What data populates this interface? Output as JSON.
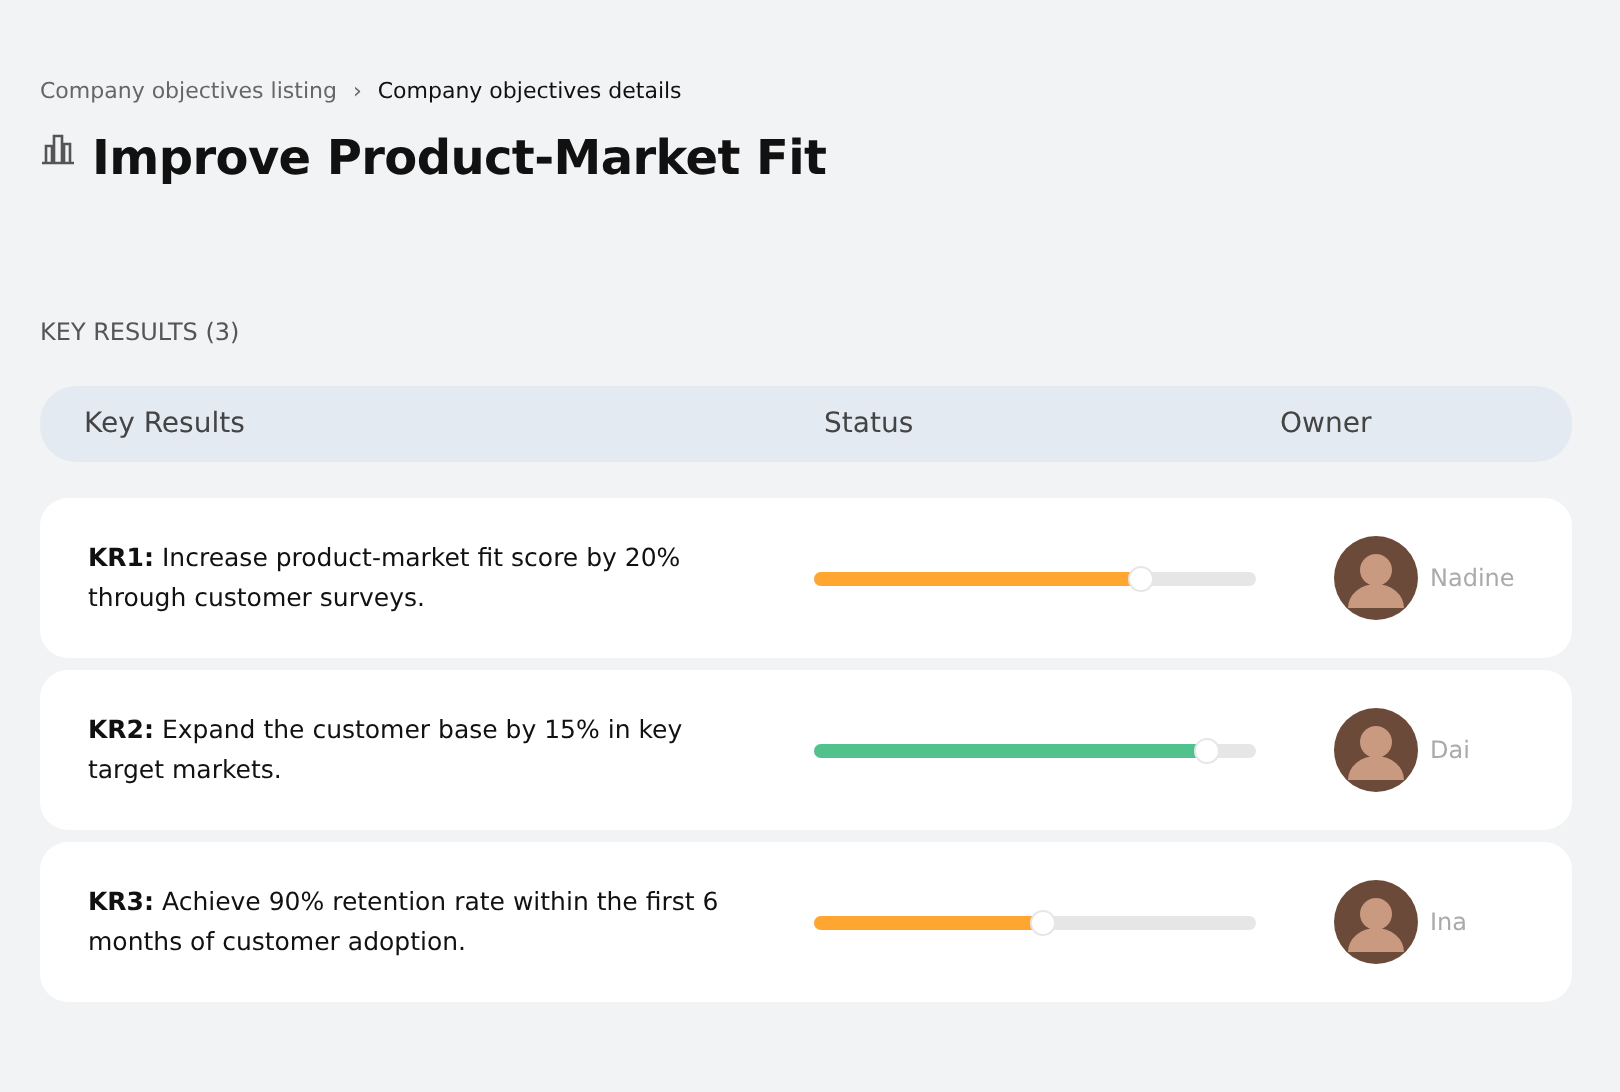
{
  "breadcrumb": [
    {
      "label": "Company objectives listing",
      "selected": false
    },
    {
      "label": "Company objectives details",
      "selected": true
    }
  ],
  "breadcrumb_separator": "›",
  "title": "Improve Product-Market Fit",
  "section_label": "KEY RESULTS (3)",
  "table": {
    "columns": [
      "Key Results",
      "Status",
      "Owner"
    ],
    "rows": [
      {
        "key_result": "**KR1:** Increase product-market fit score by 20% through customer surveys.",
        "status": {
          "level": 0.74,
          "color": "#ffa630"
        },
        "owner": "Nadine"
      },
      {
        "key_result": "**KR2:** Expand the customer base by 15% in key target markets.",
        "status": {
          "level": 0.89,
          "color": "#52c28d"
        },
        "owner": "Dai"
      },
      {
        "key_result": "**KR3:** Achieve 90% retention rate within the first 6 months of customer adoption.",
        "status": {
          "level": 0.52,
          "color": "#ffa630"
        },
        "owner": "Ina"
      }
    ]
  }
}
